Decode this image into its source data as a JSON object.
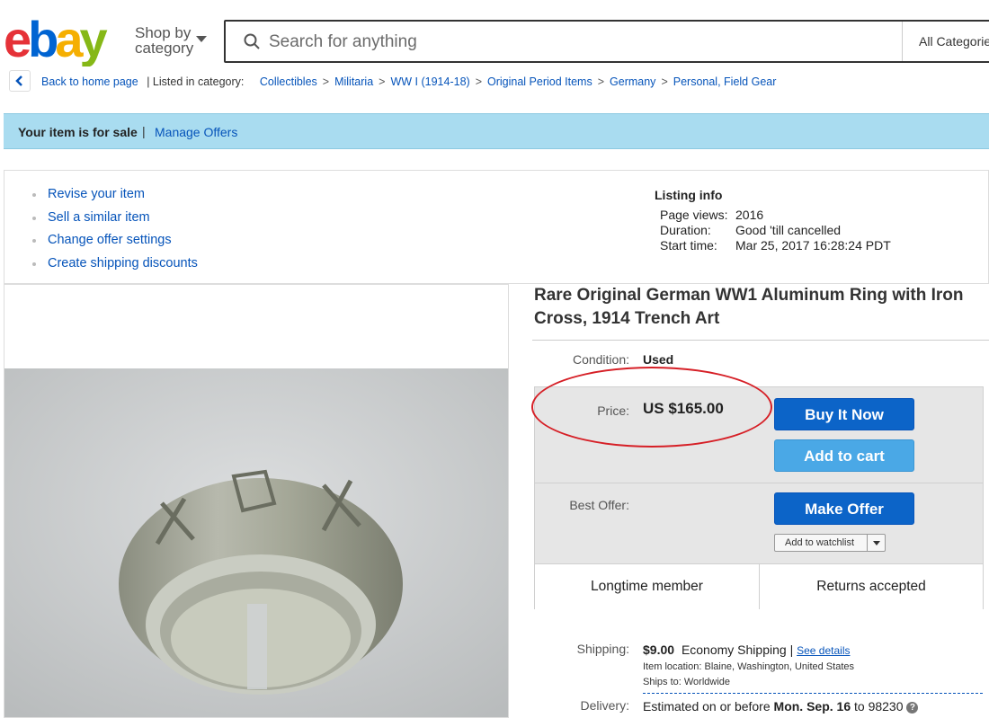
{
  "header": {
    "shop_by_line1": "Shop by",
    "shop_by_line2": "category",
    "search_placeholder": "Search for anything",
    "category_select": "All Categories"
  },
  "breadcrumb": {
    "back_label": "Back to home page",
    "listed_in": "| Listed in category:",
    "items": [
      "Collectibles",
      "Militaria",
      "WW I (1914-18)",
      "Original Period Items",
      "Germany",
      "Personal, Field Gear"
    ]
  },
  "sale_bar": {
    "status": "Your item is for sale",
    "separator": "|",
    "manage_offers": "Manage Offers"
  },
  "seller_tools": {
    "links": [
      "Revise your item",
      "Sell a similar item",
      "Change offer settings",
      "Create shipping discounts"
    ]
  },
  "listing_info": {
    "heading": "Listing info",
    "page_views_label": "Page views:",
    "page_views": "2016",
    "duration_label": "Duration:",
    "duration": "Good 'till cancelled",
    "start_time_label": "Start time:",
    "start_time": "Mar 25, 2017 16:28:24 PDT"
  },
  "item": {
    "title": "Rare Original German WW1 Aluminum Ring with Iron Cross, 1914 Trench Art",
    "condition_label": "Condition:",
    "condition": "Used",
    "price_label": "Price:",
    "price": "US $165.00",
    "buy_it_now": "Buy It Now",
    "add_to_cart": "Add to cart",
    "best_offer_label": "Best Offer:",
    "make_offer": "Make Offer",
    "add_to_watchlist": "Add to watchlist",
    "badge_1": "Longtime member",
    "badge_2": "Returns accepted"
  },
  "shipping": {
    "shipping_label": "Shipping:",
    "cost": "$9.00",
    "method": "Economy Shipping",
    "separator": "|",
    "see_details": "See details",
    "item_location": "Item location:  Blaine, Washington, United States",
    "ships_to": "Ships to:  Worldwide",
    "delivery_label": "Delivery:",
    "delivery_prefix": "Estimated on or before",
    "delivery_date": "Mon. Sep. 16",
    "delivery_suffix": "to 98230",
    "help_icon": "?"
  },
  "colors": {
    "link_blue": "#0654ba",
    "button_blue": "#0c64c8",
    "sale_bar": "#a9dcf0",
    "annotation_red": "#d61f26"
  }
}
